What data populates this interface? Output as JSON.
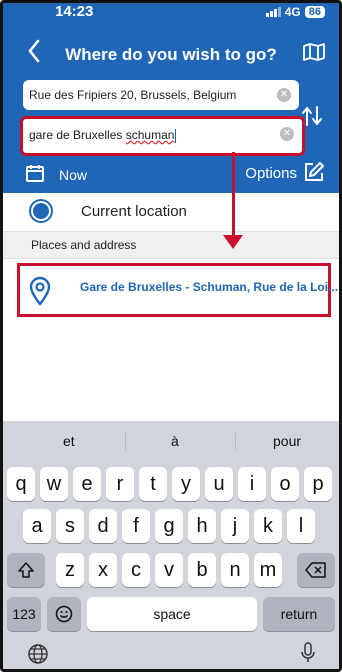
{
  "status": {
    "time": "14:23",
    "network": "4G",
    "battery": "86"
  },
  "header": {
    "title": "Where do you wish to go?"
  },
  "fields": {
    "from_value": "Rue des Fripiers 20, Brussels, Belgium",
    "to_value_prefix": "gare de Bruxelles ",
    "to_value_misspelled": "schuman"
  },
  "options_bar": {
    "now_label": "Now",
    "options_label": "Options"
  },
  "current_location_label": "Current location",
  "section_title": "Places and address",
  "result_text": "Gare de Bruxelles - Schuman, Rue de la Loi,...",
  "keyboard": {
    "suggestions": [
      "et",
      "à",
      "pour"
    ],
    "rows": [
      [
        "q",
        "w",
        "e",
        "r",
        "t",
        "y",
        "u",
        "i",
        "o",
        "p"
      ],
      [
        "a",
        "s",
        "d",
        "f",
        "g",
        "h",
        "j",
        "k",
        "l"
      ],
      [
        "z",
        "x",
        "c",
        "v",
        "b",
        "n",
        "m"
      ]
    ],
    "num_label": "123",
    "space_label": "space",
    "return_label": "return"
  },
  "colors": {
    "primary": "#1f67b6",
    "annotation": "#c8102e"
  },
  "icons": [
    "back-arrow-icon",
    "map-icon",
    "clear-icon",
    "swap-icon",
    "calendar-icon",
    "edit-icon",
    "location-pin-icon",
    "shift-icon",
    "backspace-icon",
    "emoji-icon",
    "globe-icon",
    "microphone-icon"
  ]
}
